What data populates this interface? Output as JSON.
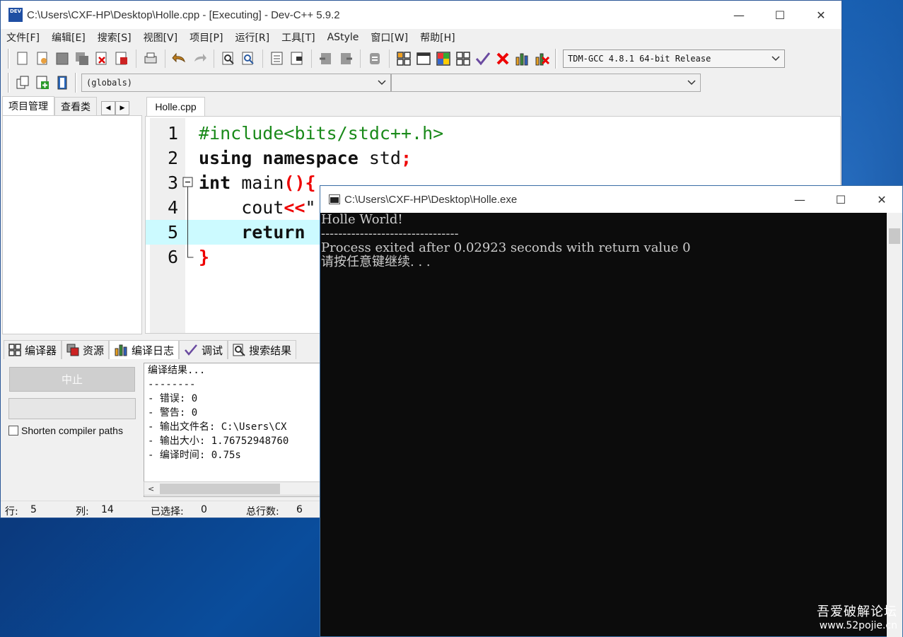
{
  "devcpp": {
    "title": "C:\\Users\\CXF-HP\\Desktop\\Holle.cpp - [Executing] - Dev-C++ 5.9.2",
    "icon_text": "DEV",
    "window_controls": {
      "minimize": "—",
      "maximize": "☐",
      "close": "✕"
    },
    "menu": [
      "文件[F]",
      "编辑[E]",
      "搜索[S]",
      "视图[V]",
      "项目[P]",
      "运行[R]",
      "工具[T]",
      "AStyle",
      "窗口[W]",
      "帮助[H]"
    ],
    "compiler": "TDM-GCC 4.8.1 64-bit Release",
    "scope_combo": "(globals)",
    "function_combo": "",
    "left_tabs": [
      "项目管理",
      "查看类"
    ],
    "editor_tab": "Holle.cpp",
    "code_lines": [
      {
        "num": "1",
        "parts": [
          {
            "t": "#include<bits/stdc++.h>",
            "c": "pp"
          }
        ]
      },
      {
        "num": "2",
        "parts": [
          {
            "t": "using namespace",
            "c": "kw"
          },
          {
            "t": " std",
            "c": ""
          },
          {
            "t": ";",
            "c": "sym"
          }
        ]
      },
      {
        "num": "3",
        "parts": [
          {
            "t": "int",
            "c": "kw"
          },
          {
            "t": " main",
            "c": ""
          },
          {
            "t": "(){",
            "c": "sym"
          }
        ]
      },
      {
        "num": "4",
        "parts": [
          {
            "t": "    cout",
            "c": ""
          },
          {
            "t": "<<",
            "c": "sym"
          },
          {
            "t": "\"",
            "c": ""
          }
        ]
      },
      {
        "num": "5",
        "parts": [
          {
            "t": "    return",
            "c": "kw"
          }
        ]
      },
      {
        "num": "6",
        "parts": [
          {
            "t": "}",
            "c": "sym"
          }
        ]
      }
    ],
    "bottom_tabs": [
      "编译器",
      "资源",
      "编译日志",
      "调试",
      "搜索结果"
    ],
    "active_bottom_tab": "编译日志",
    "stop_button": "中止",
    "shorten_label": "Shorten compiler paths",
    "log_lines": [
      "编译结果...",
      "--------",
      "- 错误: 0",
      "- 警告: 0",
      "- 输出文件名: C:\\Users\\CX",
      "- 输出大小: 1.76752948760",
      "- 编译时间: 0.75s"
    ],
    "status": {
      "row_label": "行:",
      "row_value": "5",
      "col_label": "列:",
      "col_value": "14",
      "sel_label": "已选择:",
      "sel_value": "0",
      "total_label": "总行数:",
      "total_value": "6"
    }
  },
  "console": {
    "title": "C:\\Users\\CXF-HP\\Desktop\\Holle.exe",
    "window_controls": {
      "minimize": "—",
      "maximize": "☐",
      "close": "✕"
    },
    "lines": [
      "Holle World!",
      "--------------------------------",
      "Process exited after 0.02923 seconds with return value 0",
      "请按任意键继续. . ."
    ]
  },
  "watermark": {
    "name": "吾爱破解论坛",
    "url": "www.52pojie.cn"
  }
}
